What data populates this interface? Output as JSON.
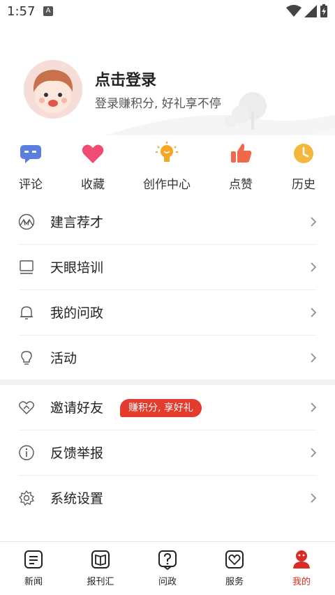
{
  "status_bar": {
    "time": "1:57",
    "notification": "A"
  },
  "profile": {
    "title": "点击登录",
    "subtitle": "登录赚积分, 好礼享不停"
  },
  "quick_actions": [
    {
      "label": "评论",
      "icon": "comment-icon",
      "color": "#5b7fe0"
    },
    {
      "label": "收藏",
      "icon": "heart-icon",
      "color": "#f04b73"
    },
    {
      "label": "创作中心",
      "icon": "lightbulb-icon",
      "color": "#f5a623"
    },
    {
      "label": "点赞",
      "icon": "thumbs-up-icon",
      "color": "#f2684a"
    },
    {
      "label": "历史",
      "icon": "clock-icon",
      "color": "#f5b73b"
    }
  ],
  "menu_group1": [
    {
      "label": "建言荐才",
      "icon": "mountain-icon"
    },
    {
      "label": "天眼培训",
      "icon": "monitor-icon"
    },
    {
      "label": "我的问政",
      "icon": "bell-icon"
    },
    {
      "label": "活动",
      "icon": "bulb-icon"
    }
  ],
  "menu_group2": [
    {
      "label": "邀请好友",
      "icon": "handshake-heart-icon",
      "badge": "赚积分, 享好礼"
    },
    {
      "label": "反馈举报",
      "icon": "info-icon"
    },
    {
      "label": "系统设置",
      "icon": "gear-icon"
    }
  ],
  "tabbar": [
    {
      "label": "新闻",
      "icon": "news-icon",
      "active": false
    },
    {
      "label": "报刊汇",
      "icon": "book-icon",
      "active": false
    },
    {
      "label": "问政",
      "icon": "question-icon",
      "active": false
    },
    {
      "label": "服务",
      "icon": "heart-hand-icon",
      "active": false
    },
    {
      "label": "我的",
      "icon": "profile-icon",
      "active": true
    }
  ],
  "colors": {
    "accent": "#d92b24",
    "badge": "#e33b2d"
  }
}
